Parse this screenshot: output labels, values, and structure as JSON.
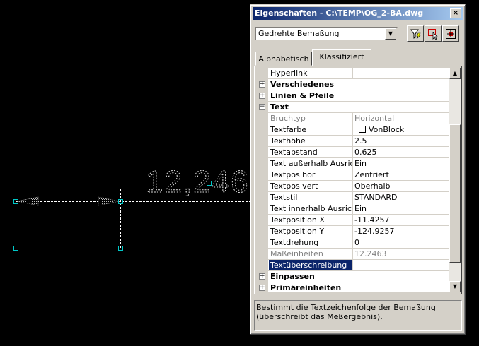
{
  "cad": {
    "dimension_text": "12,246"
  },
  "window": {
    "title": "Eigenschaften - C:\\TEMP\\OG_2-BA.dwg",
    "close_label": "×",
    "object_type": "Gedrehte Bemaßung",
    "tabs": [
      {
        "label": "Alphabetisch",
        "active": false
      },
      {
        "label": "Klassifiziert",
        "active": true
      }
    ],
    "toolbar": [
      {
        "icon": "quick-select-icon"
      },
      {
        "icon": "select-objects-icon"
      },
      {
        "icon": "pickadd-icon"
      }
    ]
  },
  "properties": [
    {
      "kind": "prop",
      "name": "Hyperlink",
      "value": ""
    },
    {
      "kind": "cat",
      "name": "Verschiedenes",
      "expander": "+"
    },
    {
      "kind": "cat",
      "name": "Linien & Pfeile",
      "expander": "+"
    },
    {
      "kind": "cat",
      "name": "Text",
      "expander": "−"
    },
    {
      "kind": "prop",
      "name": "Bruchtyp",
      "value": "Horizontal",
      "disabled": true
    },
    {
      "kind": "prop",
      "name": "Textfarbe",
      "value": "VonBlock",
      "swatch": "#ffffff"
    },
    {
      "kind": "prop",
      "name": "Texthöhe",
      "value": "2.5"
    },
    {
      "kind": "prop",
      "name": "Textabstand",
      "value": "0.625"
    },
    {
      "kind": "prop",
      "name": "Text außerhalb Ausrichtung",
      "value": "Ein"
    },
    {
      "kind": "prop",
      "name": "Textpos hor",
      "value": "Zentriert"
    },
    {
      "kind": "prop",
      "name": "Textpos vert",
      "value": "Oberhalb"
    },
    {
      "kind": "prop",
      "name": "Textstil",
      "value": "STANDARD"
    },
    {
      "kind": "prop",
      "name": "Text innerhalb Ausrichtung",
      "value": "Ein"
    },
    {
      "kind": "prop",
      "name": "Textposition X",
      "value": "-11.4257"
    },
    {
      "kind": "prop",
      "name": "Textposition Y",
      "value": "-124.9257"
    },
    {
      "kind": "prop",
      "name": "Textdrehung",
      "value": "0"
    },
    {
      "kind": "prop",
      "name": "Maßeinheiten",
      "value": "12.2463",
      "disabled": true
    },
    {
      "kind": "prop",
      "name": "Textüberschreibung",
      "value": "",
      "selected": true
    },
    {
      "kind": "cat",
      "name": "Einpassen",
      "expander": "+"
    },
    {
      "kind": "cat",
      "name": "Primäreinheiten",
      "expander": "+"
    }
  ],
  "scrollbar": {
    "up": "▲",
    "down": "▼"
  },
  "description": "Bestimmt die Textzeichenfolge der Bemaßung (überschreibt das Meßergebnis).",
  "colors": {
    "titlebar": "#0a246a",
    "selection": "#0a246a",
    "face": "#d4d0c8",
    "grip": "#00c8c8"
  }
}
